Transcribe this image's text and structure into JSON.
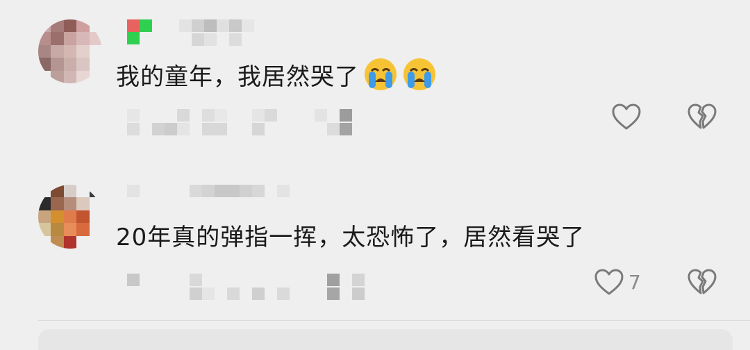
{
  "comments": [
    {
      "text": "我的童年，我居然哭了",
      "emoji": [
        "loudly-crying-face",
        "loudly-crying-face"
      ],
      "like_count": ""
    },
    {
      "text": "20年真的弹指一挥，太恐怖了，居然看哭了",
      "emoji": [],
      "like_count": "7"
    }
  ],
  "icons": {
    "like": "heart-outline-icon",
    "dislike": "broken-heart-outline-icon"
  },
  "colors": {
    "background": "#efefef",
    "text": "#1a1a1a",
    "icon": "#7a7a7a",
    "emoji_face": "#f6c335",
    "emoji_tears": "#3d9be9"
  }
}
